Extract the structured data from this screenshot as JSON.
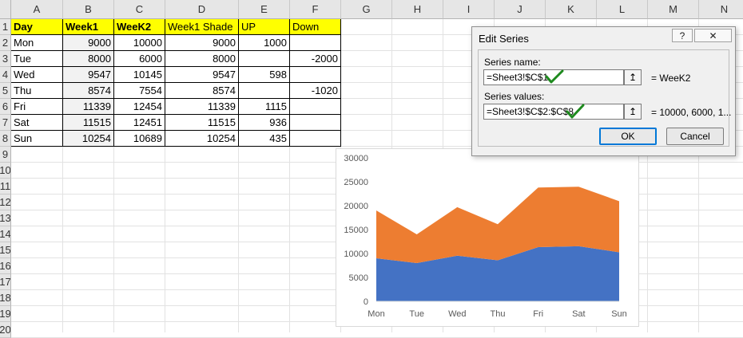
{
  "columns": [
    "A",
    "B",
    "C",
    "D",
    "E",
    "F",
    "G",
    "H",
    "I",
    "J",
    "K",
    "L",
    "M",
    "N"
  ],
  "rows": [
    "1",
    "2",
    "3",
    "4",
    "5",
    "6",
    "7",
    "8",
    "9",
    "10",
    "11",
    "12",
    "13",
    "14",
    "15",
    "16",
    "17",
    "18",
    "19",
    "20"
  ],
  "table": {
    "headers": [
      "Day",
      "Week1",
      "WeeK2",
      "Week1 Shade",
      "UP",
      "Down"
    ],
    "rows": [
      [
        "Mon",
        "9000",
        "10000",
        "9000",
        "1000",
        ""
      ],
      [
        "Tue",
        "8000",
        "6000",
        "8000",
        "",
        "-2000"
      ],
      [
        "Wed",
        "9547",
        "10145",
        "9547",
        "598",
        ""
      ],
      [
        "Thu",
        "8574",
        "7554",
        "8574",
        "",
        "-1020"
      ],
      [
        "Fri",
        "11339",
        "12454",
        "11339",
        "1115",
        ""
      ],
      [
        "Sat",
        "11515",
        "12451",
        "11515",
        "936",
        ""
      ],
      [
        "Sun",
        "10254",
        "10689",
        "10254",
        "435",
        ""
      ]
    ]
  },
  "dialog": {
    "title": "Edit Series",
    "help_label": "?",
    "close_label": "✕",
    "series_name_label": "Series name:",
    "series_name_value": "=Sheet3!$C$1",
    "series_name_preview": "= WeeK2",
    "series_values_label": "Series values:",
    "series_values_value": "=Sheet3!$C$2:$C$8",
    "series_values_preview": "= 10000, 6000, 1...",
    "ok_label": "OK",
    "cancel_label": "Cancel",
    "collapse_icon": "↥"
  },
  "colors": {
    "header_fill": "#FFFF00",
    "series1": "#4472C4",
    "series2": "#ED7D31",
    "check": "#1E8A1E"
  },
  "chart_data": {
    "type": "area",
    "stacked": true,
    "categories": [
      "Mon",
      "Tue",
      "Wed",
      "Thu",
      "Fri",
      "Sat",
      "Sun"
    ],
    "series": [
      {
        "values": [
          9000,
          8000,
          9547,
          8574,
          11339,
          11515,
          10254
        ],
        "color": "#4472C4"
      },
      {
        "values": [
          10000,
          6000,
          10145,
          7554,
          12454,
          12451,
          10689
        ],
        "color": "#ED7D31"
      }
    ],
    "ylim": [
      0,
      30000
    ],
    "yticks": [
      0,
      5000,
      10000,
      15000,
      20000,
      25000,
      30000
    ],
    "grid": false,
    "legend": "none"
  }
}
